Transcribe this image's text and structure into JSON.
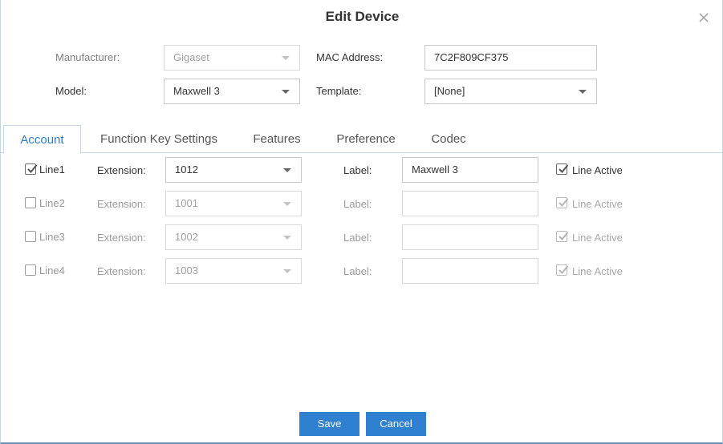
{
  "dialog": {
    "title": "Edit Device"
  },
  "fields": {
    "manufacturer_label": "Manufacturer:",
    "manufacturer_value": "Gigaset",
    "mac_label": "MAC Address:",
    "mac_value": "7C2F809CF375",
    "model_label": "Model:",
    "model_value": "Maxwell 3",
    "template_label": "Template:",
    "template_value": "[None]"
  },
  "tabs": [
    {
      "label": "Account",
      "active": true
    },
    {
      "label": "Function Key Settings",
      "active": false
    },
    {
      "label": "Features",
      "active": false
    },
    {
      "label": "Preference",
      "active": false
    },
    {
      "label": "Codec",
      "active": false
    }
  ],
  "lines": [
    {
      "name": "Line1",
      "enabled": true,
      "checked": true,
      "extension_label": "Extension:",
      "extension": "1012",
      "label_label": "Label:",
      "label_value": "Maxwell 3",
      "active_label": "Line Active",
      "active_checked": true
    },
    {
      "name": "Line2",
      "enabled": false,
      "checked": false,
      "extension_label": "Extension:",
      "extension": "1001",
      "label_label": "Label:",
      "label_value": "",
      "active_label": "Line Active",
      "active_checked": true
    },
    {
      "name": "Line3",
      "enabled": false,
      "checked": false,
      "extension_label": "Extension:",
      "extension": "1002",
      "label_label": "Label:",
      "label_value": "",
      "active_label": "Line Active",
      "active_checked": true
    },
    {
      "name": "Line4",
      "enabled": false,
      "checked": false,
      "extension_label": "Extension:",
      "extension": "1003",
      "label_label": "Label:",
      "label_value": "",
      "active_label": "Line Active",
      "active_checked": true
    }
  ],
  "buttons": {
    "save": "Save",
    "cancel": "Cancel"
  },
  "colors": {
    "accent": "#2f80d0",
    "tab_active_text": "#2e7ec8"
  }
}
